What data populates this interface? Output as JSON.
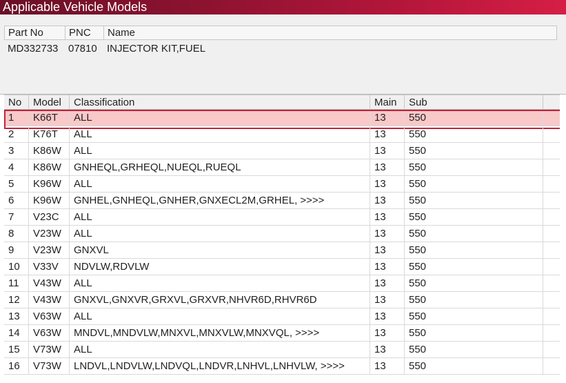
{
  "window": {
    "title": "Applicable Vehicle Models"
  },
  "part": {
    "headers": {
      "part_no": "Part No",
      "pnc": "PNC",
      "name": "Name"
    },
    "row": {
      "part_no": "MD332733",
      "pnc": "07810",
      "name": "INJECTOR KIT,FUEL"
    }
  },
  "grid": {
    "headers": {
      "no": "No",
      "model": "Model",
      "classification": "Classification",
      "main": "Main",
      "sub": "Sub"
    },
    "selected_row": 1,
    "rows": [
      {
        "no": "1",
        "model": "K66T",
        "classification": "ALL",
        "main": "13",
        "sub": "550"
      },
      {
        "no": "2",
        "model": "K76T",
        "classification": "ALL",
        "main": "13",
        "sub": "550"
      },
      {
        "no": "3",
        "model": "K86W",
        "classification": "ALL",
        "main": "13",
        "sub": "550"
      },
      {
        "no": "4",
        "model": "K86W",
        "classification": "GNHEQL,GRHEQL,NUEQL,RUEQL",
        "main": "13",
        "sub": "550"
      },
      {
        "no": "5",
        "model": "K96W",
        "classification": "ALL",
        "main": "13",
        "sub": "550"
      },
      {
        "no": "6",
        "model": "K96W",
        "classification": "GNHEL,GNHEQL,GNHER,GNXECL2M,GRHEL,  >>>>",
        "main": "13",
        "sub": "550"
      },
      {
        "no": "7",
        "model": "V23C",
        "classification": "ALL",
        "main": "13",
        "sub": "550"
      },
      {
        "no": "8",
        "model": "V23W",
        "classification": "ALL",
        "main": "13",
        "sub": "550"
      },
      {
        "no": "9",
        "model": "V23W",
        "classification": "GNXVL",
        "main": "13",
        "sub": "550"
      },
      {
        "no": "10",
        "model": "V33V",
        "classification": "NDVLW,RDVLW",
        "main": "13",
        "sub": "550"
      },
      {
        "no": "11",
        "model": "V43W",
        "classification": "ALL",
        "main": "13",
        "sub": "550"
      },
      {
        "no": "12",
        "model": "V43W",
        "classification": "GNXVL,GNXVR,GRXVL,GRXVR,NHVR6D,RHVR6D",
        "main": "13",
        "sub": "550"
      },
      {
        "no": "13",
        "model": "V63W",
        "classification": "ALL",
        "main": "13",
        "sub": "550"
      },
      {
        "no": "14",
        "model": "V63W",
        "classification": "MNDVL,MNDVLW,MNXVL,MNXVLW,MNXVQL,  >>>>",
        "main": "13",
        "sub": "550"
      },
      {
        "no": "15",
        "model": "V73W",
        "classification": "ALL",
        "main": "13",
        "sub": "550"
      },
      {
        "no": "16",
        "model": "V73W",
        "classification": "LNDVL,LNDVLW,LNDVQL,LNDVR,LNHVL,LNHVLW,  >>>>",
        "main": "13",
        "sub": "550"
      }
    ]
  },
  "colors": {
    "titlebar_start": "#6a1026",
    "titlebar_end": "#d61e45",
    "selection_fill": "#f9c9c9",
    "selection_border": "#c0243a"
  }
}
